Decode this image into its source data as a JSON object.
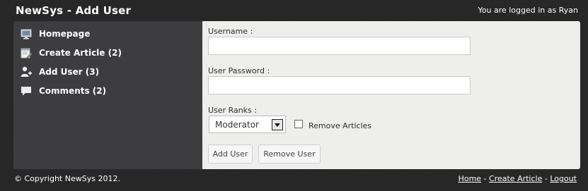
{
  "header": {
    "title": "NewSys - Add User",
    "login_status": "You are logged in as Ryan"
  },
  "sidebar": {
    "items": [
      {
        "label": "Homepage",
        "icon": "monitor-icon"
      },
      {
        "label": "Create Article (2)",
        "icon": "edit-page-icon"
      },
      {
        "label": "Add User (3)",
        "icon": "add-user-icon"
      },
      {
        "label": "Comments (2)",
        "icon": "speech-bubble-icon"
      }
    ]
  },
  "form": {
    "username_label": "Username :",
    "username_value": "",
    "password_label": "User Password :",
    "password_value": "",
    "ranks_label": "User Ranks :",
    "rank_selected": "Moderator",
    "remove_articles_label": "Remove Articles",
    "remove_articles_checked": false,
    "add_button": "Add User",
    "remove_button": "Remove User"
  },
  "footer": {
    "copyright": "© Copyright NewSys 2012.",
    "links": [
      "Home",
      "Create Article",
      "Logout"
    ],
    "separator": " - "
  },
  "colors": {
    "background": "#262626",
    "sidebar": "#3d3d3f",
    "content": "#eeefed"
  }
}
